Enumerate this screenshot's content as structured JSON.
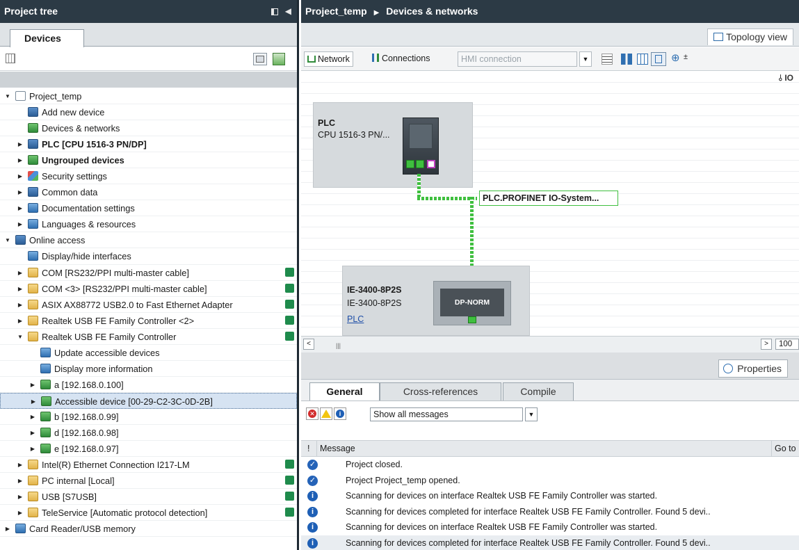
{
  "left": {
    "title": "Project tree",
    "header_icons": [
      "panel-icon",
      "collapse-left-icon"
    ],
    "devices_tab": "Devices",
    "tree": [
      {
        "label": "Project_temp",
        "expanded": true,
        "depth": 0,
        "icon": "project-icon"
      },
      {
        "label": "Add new device",
        "depth": 1,
        "icon": "add-device-icon"
      },
      {
        "label": "Devices & networks",
        "depth": 1,
        "icon": "network-icon"
      },
      {
        "label": "PLC [CPU 1516-3 PN/DP]",
        "depth": 1,
        "bold": true,
        "icon": "plc-icon",
        "collapsed": true
      },
      {
        "label": "Ungrouped devices",
        "depth": 1,
        "bold": true,
        "icon": "ungrouped-icon",
        "collapsed": true
      },
      {
        "label": "Security settings",
        "depth": 1,
        "icon": "security-icon",
        "collapsed": true
      },
      {
        "label": "Common data",
        "depth": 1,
        "icon": "common-data-icon",
        "collapsed": true
      },
      {
        "label": "Documentation settings",
        "depth": 1,
        "icon": "documentation-icon",
        "collapsed": true
      },
      {
        "label": "Languages & resources",
        "depth": 1,
        "icon": "languages-icon",
        "collapsed": true
      },
      {
        "label": "Online access",
        "depth": 0,
        "expanded": true,
        "icon": "online-access-icon"
      },
      {
        "label": "Display/hide interfaces",
        "depth": 1,
        "icon": "interface-icon"
      },
      {
        "label": "COM [RS232/PPI multi-master cable]",
        "depth": 1,
        "icon": "folder-icon",
        "collapsed": true,
        "status": "status-icon"
      },
      {
        "label": "COM <3> [RS232/PPI multi-master cable]",
        "depth": 1,
        "icon": "folder-icon",
        "collapsed": true,
        "status": "status-icon"
      },
      {
        "label": "ASIX AX88772 USB2.0 to Fast Ethernet Adapter",
        "depth": 1,
        "icon": "folder-icon",
        "collapsed": true,
        "status": "status-icon"
      },
      {
        "label": "Realtek USB FE Family Controller <2>",
        "depth": 1,
        "icon": "folder-icon",
        "collapsed": true,
        "status": "status-icon"
      },
      {
        "label": "Realtek USB FE Family Controller",
        "depth": 1,
        "icon": "folder-icon",
        "expanded": true,
        "status": "status-icon"
      },
      {
        "label": "Update accessible devices",
        "depth": 2,
        "icon": "update-devices-icon"
      },
      {
        "label": "Display more information",
        "depth": 2,
        "icon": "info-icon"
      },
      {
        "label": "a [192.168.0.100]",
        "depth": 2,
        "icon": "device-icon",
        "collapsed": true
      },
      {
        "label": "Accessible device [00-29-C2-3C-0D-2B]",
        "depth": 2,
        "icon": "device-icon",
        "collapsed": true,
        "selected": true
      },
      {
        "label": "b [192.168.0.99]",
        "depth": 2,
        "icon": "device-icon",
        "collapsed": true
      },
      {
        "label": "d [192.168.0.98]",
        "depth": 2,
        "icon": "device-icon",
        "collapsed": true
      },
      {
        "label": "e [192.168.0.97]",
        "depth": 2,
        "icon": "device-icon",
        "collapsed": true
      },
      {
        "label": "Intel(R) Ethernet Connection I217-LM",
        "depth": 1,
        "icon": "folder-icon",
        "collapsed": true,
        "status": "status-icon"
      },
      {
        "label": "PC internal [Local]",
        "depth": 1,
        "icon": "folder-icon",
        "collapsed": true,
        "status": "status-icon"
      },
      {
        "label": "USB [S7USB]",
        "depth": 1,
        "icon": "folder-icon",
        "collapsed": true,
        "status": "status-icon"
      },
      {
        "label": "TeleService [Automatic protocol detection]",
        "depth": 1,
        "icon": "folder-icon",
        "collapsed": true,
        "status": "status-icon"
      },
      {
        "label": "Card Reader/USB memory",
        "depth": 0,
        "icon": "card-reader-icon",
        "collapsed": true
      }
    ]
  },
  "right": {
    "breadcrumb": [
      "Project_temp",
      "Devices & networks"
    ],
    "topology_tab": "Topology view",
    "toolbar": {
      "network": "Network",
      "connections": "Connections",
      "hmi_connection": "HMI connection",
      "io_label": "IO"
    },
    "canvas": {
      "plc": {
        "name": "PLC",
        "type": "CPU 1516-3 PN/..."
      },
      "profinet_label": "PLC.PROFINET IO-System...",
      "switch": {
        "name": "IE-3400-8P2S",
        "type": "IE-3400-8P2S",
        "link": "PLC",
        "module": "DP-NORM"
      }
    },
    "scroll_zoom": "100",
    "properties_btn": "Properties",
    "tabs": [
      "General",
      "Cross-references",
      "Compile"
    ],
    "filter_value": "Show all messages",
    "msg_header": {
      "col1": "!",
      "col2": "Message",
      "col3": "Go to"
    },
    "messages": [
      {
        "type": "ok",
        "text": "Project closed."
      },
      {
        "type": "ok",
        "text": "Project Project_temp opened."
      },
      {
        "type": "info",
        "text": "Scanning for devices on interface Realtek USB FE Family Controller was started."
      },
      {
        "type": "info",
        "text": "Scanning for devices completed for interface Realtek USB FE Family Controller. Found 5 devi.."
      },
      {
        "type": "info",
        "text": "Scanning for devices on interface Realtek USB FE Family Controller was started."
      },
      {
        "type": "info",
        "text": "Scanning for devices completed for interface Realtek USB FE Family Controller. Found 5 devi.."
      }
    ]
  },
  "colors": {
    "header": "#2c3a45",
    "accent_green": "#3fbf3f",
    "info_blue": "#1e5fb5",
    "error_red": "#d22c2c",
    "warn_yellow": "#f2c511"
  }
}
